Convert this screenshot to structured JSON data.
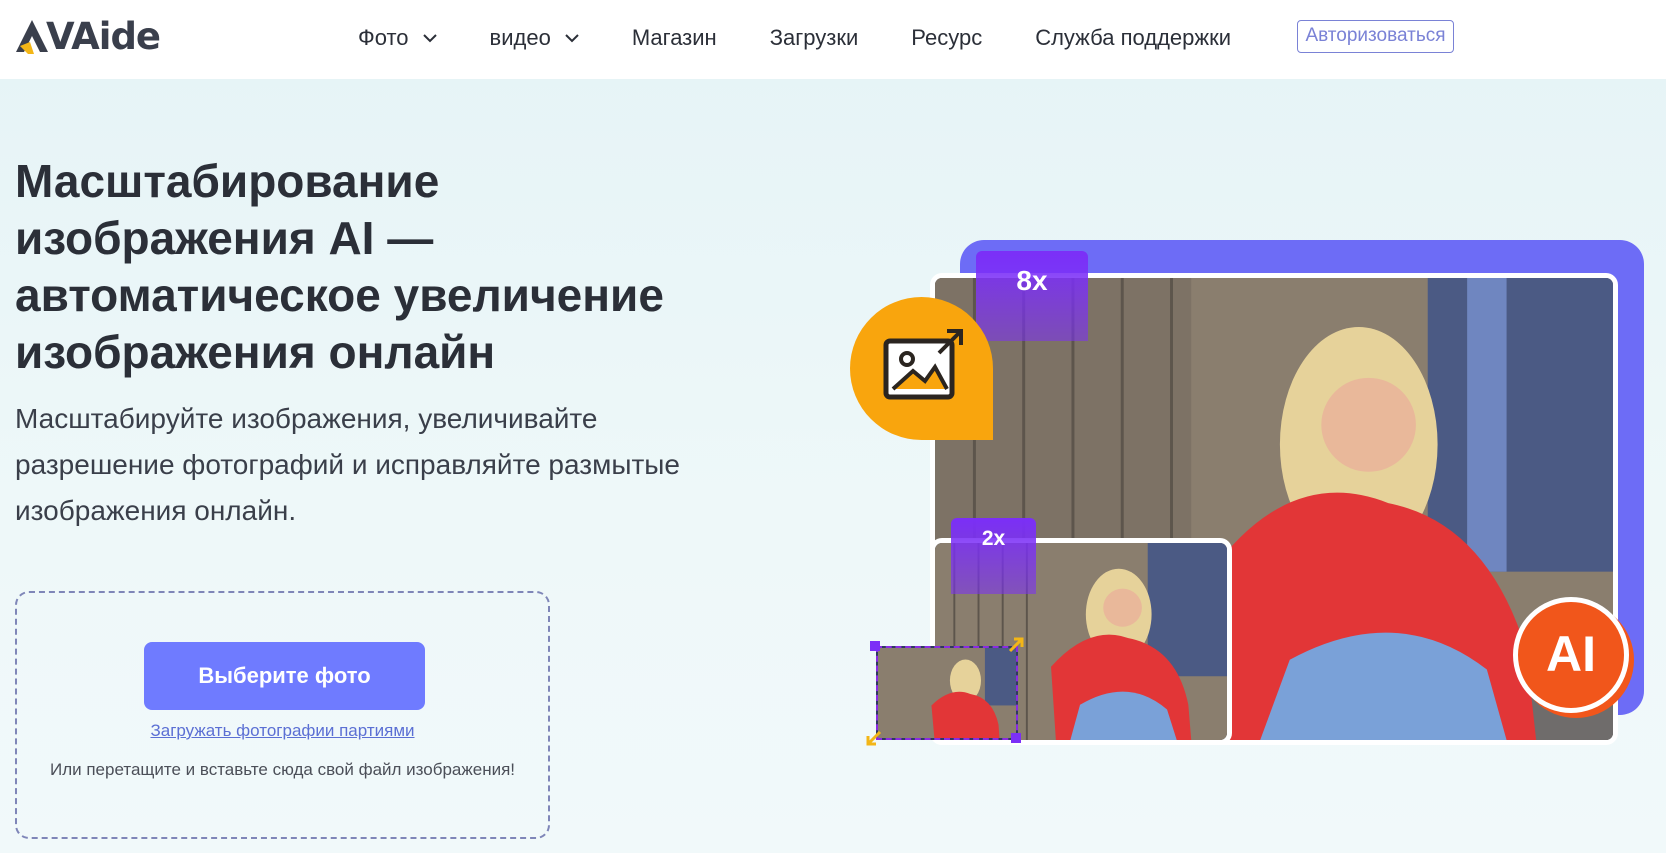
{
  "header": {
    "logo_text": "VAide",
    "nav": [
      {
        "label": "Фото",
        "has_dropdown": true
      },
      {
        "label": "видео",
        "has_dropdown": true
      },
      {
        "label": "Магазин",
        "has_dropdown": false
      },
      {
        "label": "Загрузки",
        "has_dropdown": false
      },
      {
        "label": "Ресурс",
        "has_dropdown": false
      },
      {
        "label": "Служба поддержки",
        "has_dropdown": false
      }
    ],
    "login_label": "Авторизоваться"
  },
  "hero": {
    "title": "Масштабирование изображения AI — автоматическое увеличение изображения онлайн",
    "subtitle": "Масштабируйте изображения, увеличивайте разрешение фотографий и исправляйте размытые изображения онлайн."
  },
  "upload": {
    "choose_label": "Выберите фото",
    "batch_link": "Загружать фотографии партиями",
    "drop_hint": "Или перетащите и вставьте сюда свой файл изображения!"
  },
  "illustration": {
    "badge_large": "8x",
    "badge_small": "2x",
    "ai_label": "AI",
    "icon": "image-upscale-icon"
  },
  "colors": {
    "accent": "#6f7bff",
    "purple": "#6d6cf6",
    "orange": "#f9a50d",
    "ai_red": "#f1561b",
    "text": "#2b2f38"
  }
}
